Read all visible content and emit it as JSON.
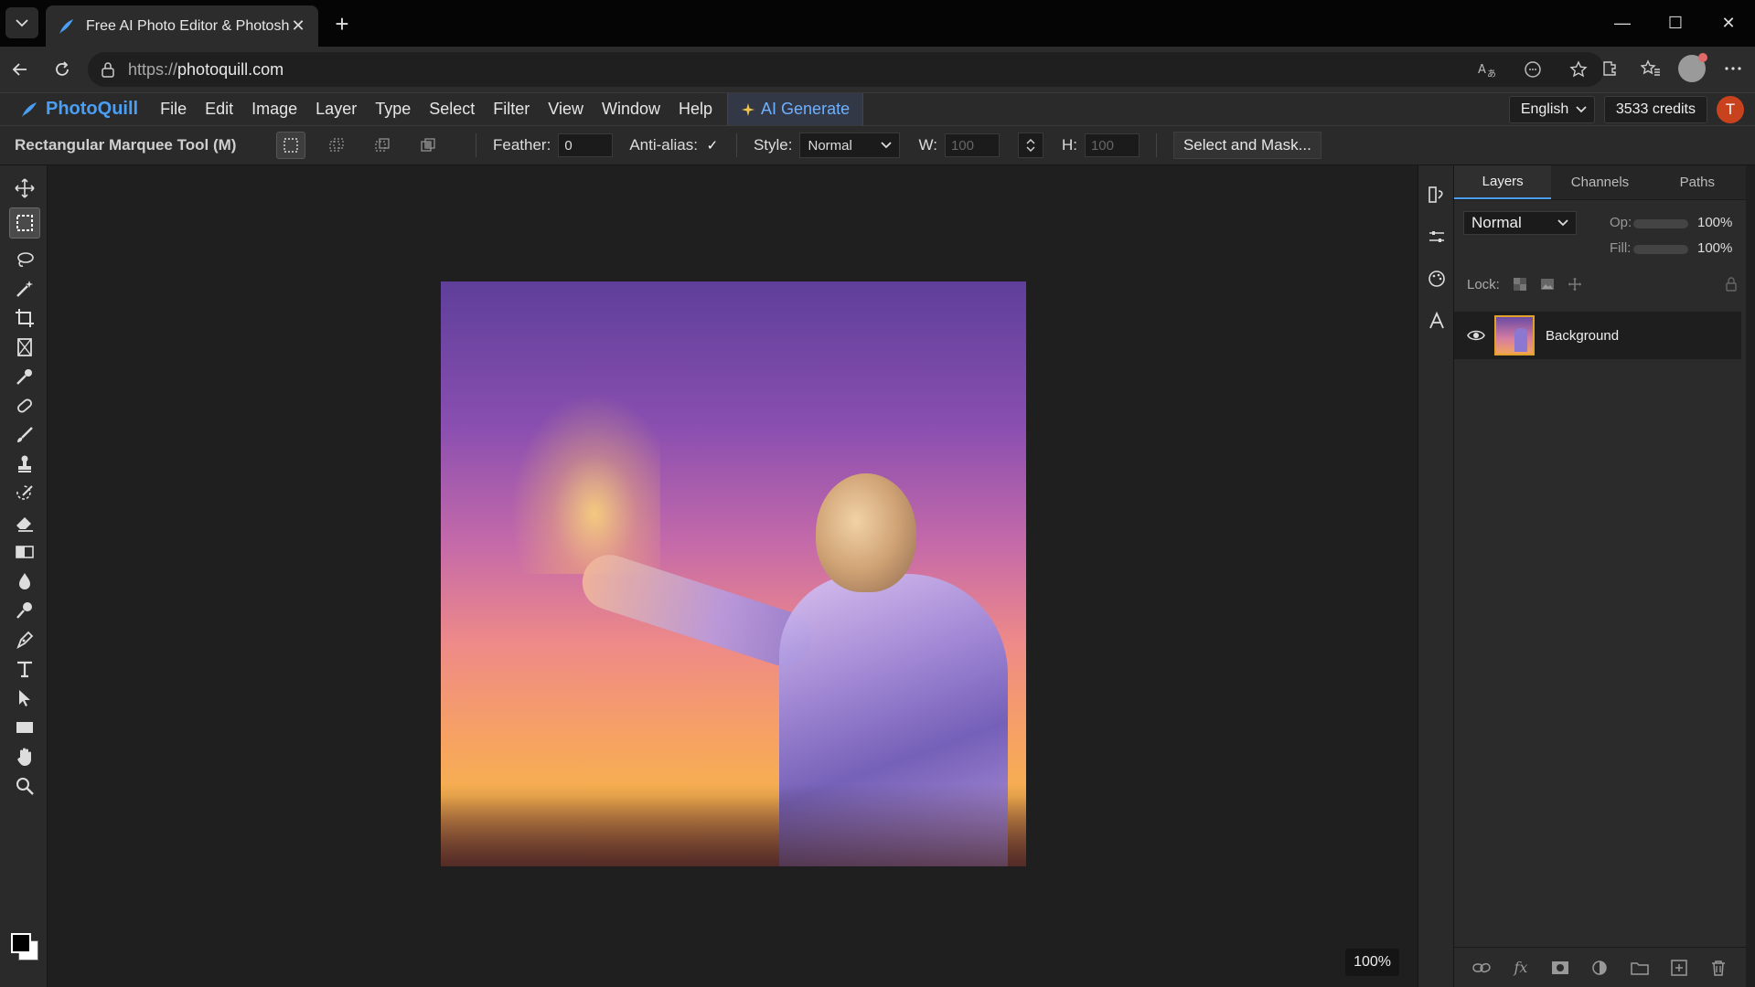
{
  "browser": {
    "tab_title": "Free AI Photo Editor & Photoshop",
    "url_scheme": "https://",
    "url_host": "photoquill.com"
  },
  "app": {
    "name": "PhotoQuill",
    "menu": [
      "File",
      "Edit",
      "Image",
      "Layer",
      "Type",
      "Select",
      "Filter",
      "View",
      "Window",
      "Help"
    ],
    "ai_generate": "AI Generate",
    "language": "English",
    "credits": "3533 credits",
    "user_initial": "T",
    "accent": "#4a9ff5"
  },
  "options": {
    "tool_name": "Rectangular Marquee Tool (M)",
    "feather_label": "Feather:",
    "feather_value": "0",
    "antialias_label": "Anti-alias:",
    "antialias_checked": true,
    "style_label": "Style:",
    "style_value": "Normal",
    "w_label": "W:",
    "w_value": "100",
    "h_label": "H:",
    "h_value": "100",
    "select_mask": "Select and Mask..."
  },
  "tools": [
    "move-tool",
    "marquee-tool",
    "lasso-tool",
    "magic-wand-tool",
    "crop-tool",
    "frame-tool",
    "eyedropper-tool",
    "healing-tool",
    "brush-tool",
    "stamp-tool",
    "history-brush-tool",
    "eraser-tool",
    "gradient-tool",
    "blur-tool",
    "dodge-tool",
    "pen-tool",
    "type-tool",
    "path-select-tool",
    "shape-tool",
    "hand-tool",
    "zoom-tool"
  ],
  "canvas": {
    "zoom": "100%"
  },
  "layers_panel": {
    "tabs": [
      "Layers",
      "Channels",
      "Paths"
    ],
    "active_tab": "Layers",
    "blend_mode": "Normal",
    "opacity_label": "Op:",
    "opacity_value": "100%",
    "fill_label": "Fill:",
    "fill_value": "100%",
    "lock_label": "Lock:",
    "layers": [
      {
        "name": "Background",
        "visible": true
      }
    ]
  }
}
